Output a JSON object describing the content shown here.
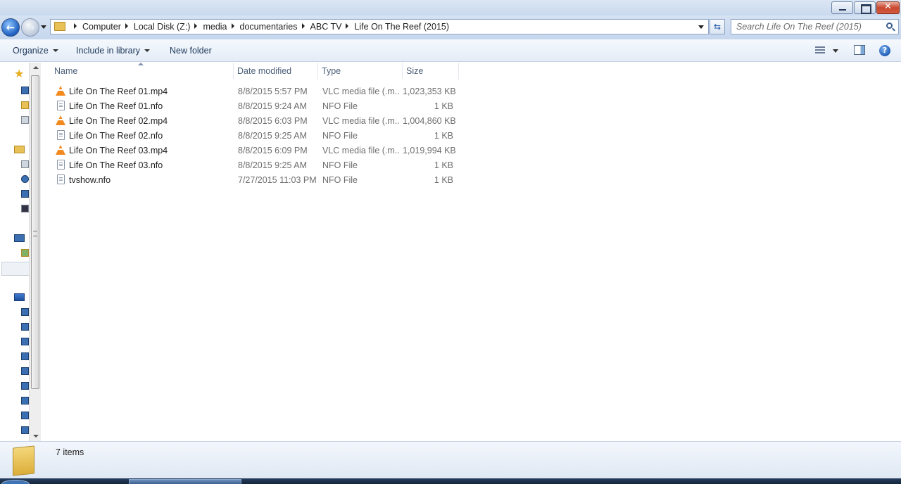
{
  "window": {
    "close_glyph": "✕"
  },
  "navigation": {
    "back_glyph": "←",
    "forward_glyph": "→"
  },
  "address": {
    "crumbs": [
      "Computer",
      "Local Disk (Z:)",
      "media",
      "documentaries",
      "ABC TV",
      "Life On The Reef (2015)"
    ],
    "refresh_glyph": "⇆"
  },
  "search": {
    "placeholder": "Search Life On The Reef (2015)"
  },
  "toolbar": {
    "organize_label": "Organize",
    "include_library_label": "Include in library",
    "new_folder_label": "New folder",
    "help_glyph": "?"
  },
  "nav_star_glyph": "★",
  "columns": {
    "name": "Name",
    "date_modified": "Date modified",
    "type": "Type",
    "size": "Size"
  },
  "files": [
    {
      "name": "Life On The Reef 01.mp4",
      "date": "8/8/2015 5:57 PM",
      "type": "VLC media file (.m...",
      "size": "1,023,353 KB",
      "icon": "vlc-icon"
    },
    {
      "name": "Life On The Reef 01.nfo",
      "date": "8/8/2015 9:24 AM",
      "type": "NFO File",
      "size": "1 KB",
      "icon": "nfo-file-icon"
    },
    {
      "name": "Life On The Reef 02.mp4",
      "date": "8/8/2015 6:03 PM",
      "type": "VLC media file (.m...",
      "size": "1,004,860 KB",
      "icon": "vlc-icon"
    },
    {
      "name": "Life On The Reef 02.nfo",
      "date": "8/8/2015 9:25 AM",
      "type": "NFO File",
      "size": "1 KB",
      "icon": "nfo-file-icon"
    },
    {
      "name": "Life On The Reef 03.mp4",
      "date": "8/8/2015 6:09 PM",
      "type": "VLC media file (.m...",
      "size": "1,019,994 KB",
      "icon": "vlc-icon"
    },
    {
      "name": "Life On The Reef 03.nfo",
      "date": "8/8/2015 9:25 AM",
      "type": "NFO File",
      "size": "1 KB",
      "icon": "nfo-file-icon"
    },
    {
      "name": "tvshow.nfo",
      "date": "7/27/2015 11:03 PM",
      "type": "NFO File",
      "size": "1 KB",
      "icon": "nfo-file-icon"
    }
  ],
  "status": {
    "item_count": "7 items"
  }
}
